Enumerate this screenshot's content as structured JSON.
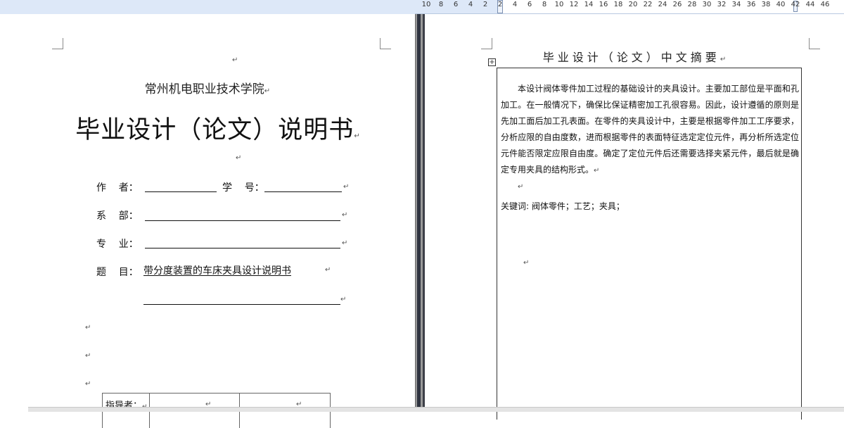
{
  "ruler": {
    "ticks": [
      "10",
      "8",
      "6",
      "4",
      "2",
      "2",
      "4",
      "6",
      "8",
      "10",
      "12",
      "14",
      "16",
      "18",
      "20",
      "22",
      "24",
      "26",
      "28",
      "30",
      "32",
      "34",
      "36",
      "38",
      "40",
      "42",
      "44",
      "46"
    ]
  },
  "cover": {
    "school": "常州机电职业技术学院",
    "title": "毕业设计（论文）说明书",
    "author_label": "作    者：",
    "student_id_label": "学    号：",
    "department_label": "系    部：",
    "major_label": "专    业：",
    "topic_label": "题    目：",
    "topic_value": "  带分度装置的车床夹具设计说明书",
    "advisor_label": "指导者："
  },
  "abstract": {
    "title": "毕业设计（论文）中文摘要",
    "body": "本设计阀体零件加工过程的基础设计的夹具设计。主要加工部位是平面和孔加工。在一般情况下，确保比保证精密加工孔很容易。因此，设计遵循的原则是先加工面后加工孔表面。在零件的夹具设计中，主要是根据零件加工工序要求，分析应限的自由度数，进而根据零件的表面特征选定定位元件，再分析所选定位元件能否限定应限自由度。确定了定位元件后还需要选择夹紧元件，最后就是确定专用夹具的结构形式。",
    "keywords": "关键词: 阀体零件；工艺；夹具；"
  },
  "marks": {
    "para": "↵"
  }
}
